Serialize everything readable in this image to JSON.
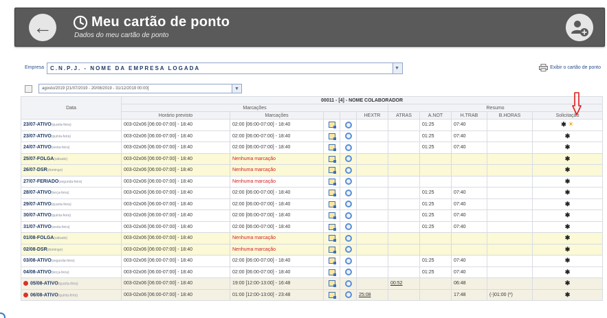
{
  "header": {
    "title": "Meu cartão de ponto",
    "subtitle": "Dados do meu cartão de ponto"
  },
  "company": {
    "label": "Empresa",
    "value": "C.N.P.J. - NOME DA EMPRESA LOGADA"
  },
  "print_label": "Exibir o cartão de ponto",
  "period": {
    "value": "agosto/2019 [21/07/2019 - 20/08/2019 - 31/12/2019 00:00]"
  },
  "table": {
    "employee": "00011 - [4] - NOME COLABORADOR",
    "col_data": "Data",
    "group_marcacoes": "Marcações",
    "group_resumo": "Resumo",
    "cols": [
      "Horário previsto",
      "Marcações",
      "",
      "",
      "HEXTR",
      "ATRAS",
      "A.NOT",
      "H.TRAB",
      "B.HORAS",
      "Solicitação"
    ],
    "rows": [
      {
        "date": "23/07-ATIVO",
        "sub": "(quarta-feira)",
        "horario": "003-02x06 [06:00-07:00] - 18:40",
        "marc": "02:00 [06:00-07:00] - 18:40",
        "nomark": false,
        "hextr": "",
        "atras": "",
        "anot": "01:25",
        "htrab": "07:40",
        "bhoras": "",
        "style": "white",
        "sun": true,
        "warn": false
      },
      {
        "date": "23/07-ATIVO",
        "sub": "(quinta-feira)",
        "horario": "003-02x06 [06:00-07:00] - 18:40",
        "marc": "02:00 [06:00-07:00] - 18:40",
        "nomark": false,
        "hextr": "",
        "atras": "",
        "anot": "01:25",
        "htrab": "07:40",
        "bhoras": "",
        "style": "white",
        "sun": false,
        "warn": false
      },
      {
        "date": "24/07-ATIVO",
        "sub": "(sexta-feira)",
        "horario": "003-02x06 [06:00-07:00] - 18:40",
        "marc": "02:00 [06:00-07:00] - 18:40",
        "nomark": false,
        "hextr": "",
        "atras": "",
        "anot": "01:25",
        "htrab": "07:40",
        "bhoras": "",
        "style": "white",
        "sun": false,
        "warn": false
      },
      {
        "date": "25/07-FOLGA",
        "sub": "(sábado)",
        "horario": "003-02x06 [06:00-07:00] - 18:40",
        "marc": "Nenhuma marcação",
        "nomark": true,
        "hextr": "",
        "atras": "",
        "anot": "",
        "htrab": "",
        "bhoras": "",
        "style": "yellow",
        "sun": false,
        "warn": false
      },
      {
        "date": "26/07-DSR",
        "sub": "(domingo)",
        "horario": "003-02x06 [06:00-07:00] - 18:40",
        "marc": "Nenhuma marcação",
        "nomark": true,
        "hextr": "",
        "atras": "",
        "anot": "",
        "htrab": "",
        "bhoras": "",
        "style": "yellow",
        "sun": false,
        "warn": false
      },
      {
        "date": "27/07-FERIADO",
        "sub": "(segunda-feira)",
        "horario": "003-02x06 [06:00-07:00] - 18:40",
        "marc": "Nenhuma marcação",
        "nomark": true,
        "hextr": "",
        "atras": "",
        "anot": "",
        "htrab": "",
        "bhoras": "",
        "style": "white",
        "sun": false,
        "warn": false
      },
      {
        "date": "28/07-ATIVO",
        "sub": "(terça-feira)",
        "horario": "003-02x06 [06:00-07:00] - 18:40",
        "marc": "02:00 [06:00-07:00] - 18:40",
        "nomark": false,
        "hextr": "",
        "atras": "",
        "anot": "01:25",
        "htrab": "07:40",
        "bhoras": "",
        "style": "white",
        "sun": false,
        "warn": false
      },
      {
        "date": "29/07-ATIVO",
        "sub": "(quarta-feira)",
        "horario": "003-02x06 [06:00-07:00] - 18:40",
        "marc": "02:00 [06:00-07:00] - 18:40",
        "nomark": false,
        "hextr": "",
        "atras": "",
        "anot": "01:25",
        "htrab": "07:40",
        "bhoras": "",
        "style": "white",
        "sun": false,
        "warn": false
      },
      {
        "date": "30/07-ATIVO",
        "sub": "(quinta-feira)",
        "horario": "003-02x06 [06:00-07:00] - 18:40",
        "marc": "02:00 [06:00-07:00] - 18:40",
        "nomark": false,
        "hextr": "",
        "atras": "",
        "anot": "01:25",
        "htrab": "07:40",
        "bhoras": "",
        "style": "white",
        "sun": false,
        "warn": false
      },
      {
        "date": "31/07-ATIVO",
        "sub": "(sexta-feira)",
        "horario": "003-02x06 [06:00-07:00] - 18:40",
        "marc": "02:00 [06:00-07:00] - 18:40",
        "nomark": false,
        "hextr": "",
        "atras": "",
        "anot": "01:25",
        "htrab": "07:40",
        "bhoras": "",
        "style": "white",
        "sun": false,
        "warn": false
      },
      {
        "date": "01/08-FOLGA",
        "sub": "(sábado)",
        "horario": "003-02x06 [06:00-07:00] - 18:40",
        "marc": "Nenhuma marcação",
        "nomark": true,
        "hextr": "",
        "atras": "",
        "anot": "",
        "htrab": "",
        "bhoras": "",
        "style": "yellow",
        "sun": false,
        "warn": false
      },
      {
        "date": "02/08-DSR",
        "sub": "(domingo)",
        "horario": "003-02x06 [06:00-07:00] - 18:40",
        "marc": "Nenhuma marcação",
        "nomark": true,
        "hextr": "",
        "atras": "",
        "anot": "",
        "htrab": "",
        "bhoras": "",
        "style": "yellow",
        "sun": false,
        "warn": false
      },
      {
        "date": "03/08-ATIVO",
        "sub": "(segunda-feira)",
        "horario": "003-02x06 [06:00-07:00] - 18:40",
        "marc": "02:00 [06:00-07:00] - 18:40",
        "nomark": false,
        "hextr": "",
        "atras": "",
        "anot": "01:25",
        "htrab": "07:40",
        "bhoras": "",
        "style": "white",
        "sun": false,
        "warn": false
      },
      {
        "date": "04/08-ATIVO",
        "sub": "(terça-feira)",
        "horario": "003-02x06 [06:00-07:00] - 18:40",
        "marc": "02:00 [06:00-07:00] - 18:40",
        "nomark": false,
        "hextr": "",
        "atras": "",
        "anot": "01:25",
        "htrab": "07:40",
        "bhoras": "",
        "style": "white",
        "sun": false,
        "warn": false
      },
      {
        "date": "05/08-ATIVO",
        "sub": "(quarta-feira)",
        "horario": "003-02x06 [06:00-07:00] - 18:40",
        "marc": "19:00 [12:00-13:00] - 16:48",
        "nomark": false,
        "hextr": "",
        "atras": "00:52",
        "anot": "",
        "htrab": "06:48",
        "bhoras": "",
        "style": "beige",
        "sun": false,
        "warn": true
      },
      {
        "date": "06/08-ATIVO",
        "sub": "(quinta-feira)",
        "horario": "003-02x06 [06:00-07:00] - 18:40",
        "marc": "01:00 [12:00-13:00] - 23:48",
        "nomark": false,
        "hextr": "25:08",
        "atras": "",
        "anot": "",
        "htrab": "17:48",
        "bhoras": "(-)01:00 (*)",
        "style": "beige",
        "sun": false,
        "warn": true
      }
    ]
  }
}
